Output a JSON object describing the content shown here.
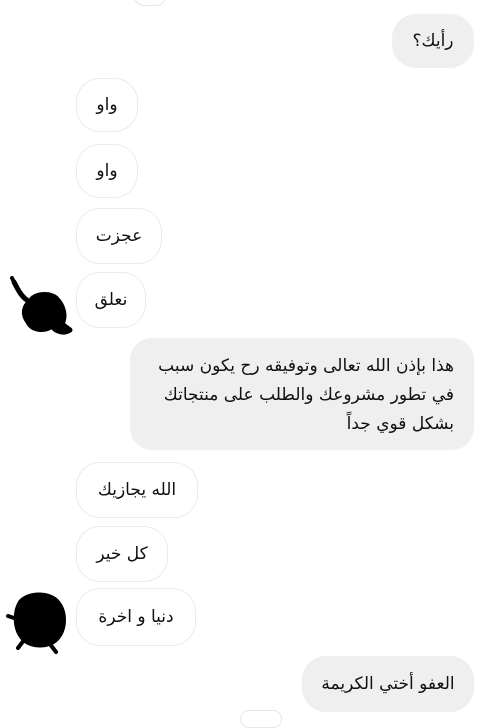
{
  "conversation": {
    "messages": [
      {
        "sender": "me",
        "text": "رأيك؟"
      },
      {
        "sender": "them",
        "text": "واو"
      },
      {
        "sender": "them",
        "text": "واو"
      },
      {
        "sender": "them",
        "text": "عجزت"
      },
      {
        "sender": "them",
        "text": "نعلق"
      },
      {
        "sender": "me",
        "lines": [
          "هذا بإذن الله تعالى وتوفيقه رح يكون سبب",
          "في تطور مشروعك والطلب على منتجاتك",
          "بشكل قوي جداً"
        ]
      },
      {
        "sender": "them",
        "text": "الله يجازيك"
      },
      {
        "sender": "them",
        "text": "كل خير"
      },
      {
        "sender": "them",
        "text": "دنيا و اخرة"
      },
      {
        "sender": "me",
        "text": "العفو أختي الكريمة"
      }
    ]
  },
  "colors": {
    "outgoing_bubble": "#efefef",
    "incoming_bubble": "#ffffff",
    "incoming_border": "#ebebeb",
    "avatar_scribble": "#000000",
    "avatar_accent": "#8fd3e0"
  }
}
